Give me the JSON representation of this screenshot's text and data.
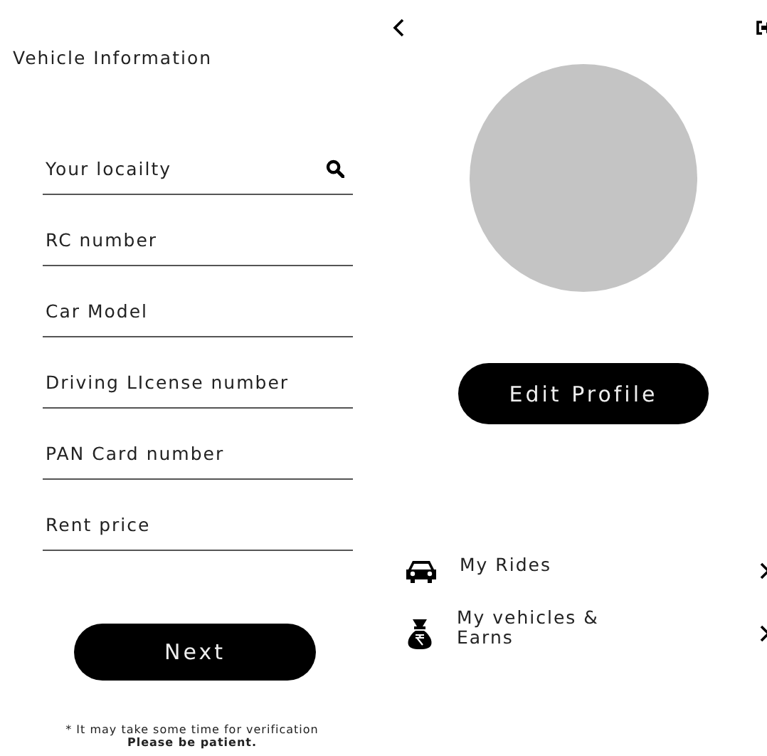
{
  "vehicle_form": {
    "title": "Vehicle Information",
    "fields": [
      {
        "placeholder": "Your locailty",
        "kind": "search"
      },
      {
        "placeholder": "RC number",
        "kind": "text"
      },
      {
        "placeholder": "Car Model",
        "kind": "text"
      },
      {
        "placeholder": "Driving LIcense number",
        "kind": "text"
      },
      {
        "placeholder": "PAN Card number",
        "kind": "text"
      },
      {
        "placeholder": "Rent price",
        "kind": "text"
      }
    ],
    "button": "Next",
    "note": "* It may take some time for verification",
    "note_bold": "Please be patient."
  },
  "profile": {
    "button": "Edit Profile",
    "menu": [
      {
        "label": "My Rides",
        "kind": "car"
      },
      {
        "label": "My vehicles &\nEarns",
        "kind": "money"
      }
    ]
  }
}
